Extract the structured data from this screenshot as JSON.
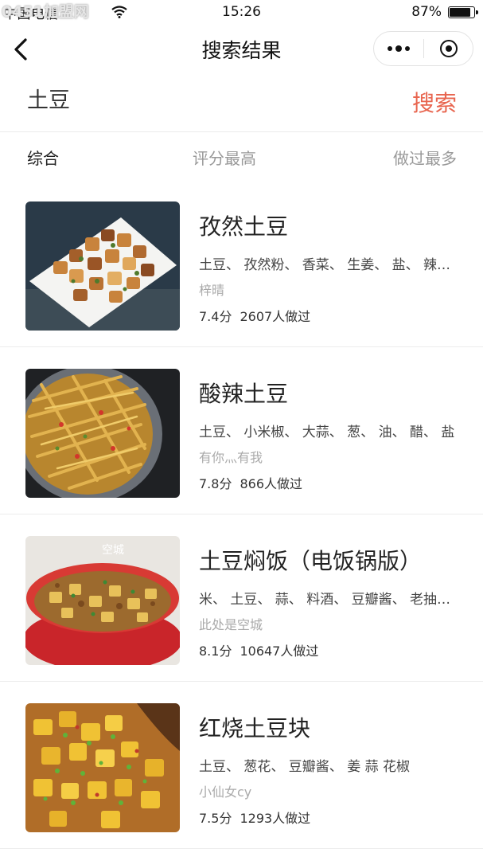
{
  "watermark": "0451加盟网",
  "status": {
    "carrier": "中国电信",
    "time": "15:26",
    "battery": "87%",
    "battery_level": 0.87
  },
  "nav": {
    "title": "搜索结果"
  },
  "search": {
    "query": "土豆",
    "button_label": "搜索"
  },
  "tabs": [
    {
      "label": "综合",
      "active": true
    },
    {
      "label": "评分最高",
      "active": false
    },
    {
      "label": "做过最多",
      "active": false
    }
  ],
  "results": [
    {
      "title": "孜然土豆",
      "ingredients": "土豆、 孜然粉、 香菜、 生姜、 盐、 辣椒粉",
      "author": "梓晴",
      "score": "7.4分",
      "made": "2607人做过",
      "image": "cumin-potato-photo"
    },
    {
      "title": "酸辣土豆",
      "ingredients": "土豆、 小米椒、 大蒜、 葱、 油、 醋、 盐",
      "author": "有你灬有我",
      "score": "7.8分",
      "made": "866人做过",
      "image": "hot-sour-potato-photo"
    },
    {
      "title": "土豆焖饭（电饭锅版）",
      "ingredients": "米、 土豆、 蒜、 料酒、 豆瓣酱、 老抽、 盐",
      "author": "此处是空城",
      "score": "8.1分",
      "made": "10647人做过",
      "image": "potato-rice-photo"
    },
    {
      "title": "红烧土豆块",
      "ingredients": "土豆、 葱花、 豆瓣酱、 姜 蒜 花椒",
      "author": "小仙女cy",
      "score": "7.5分",
      "made": "1293人做过",
      "image": "braised-potato-photo"
    }
  ]
}
